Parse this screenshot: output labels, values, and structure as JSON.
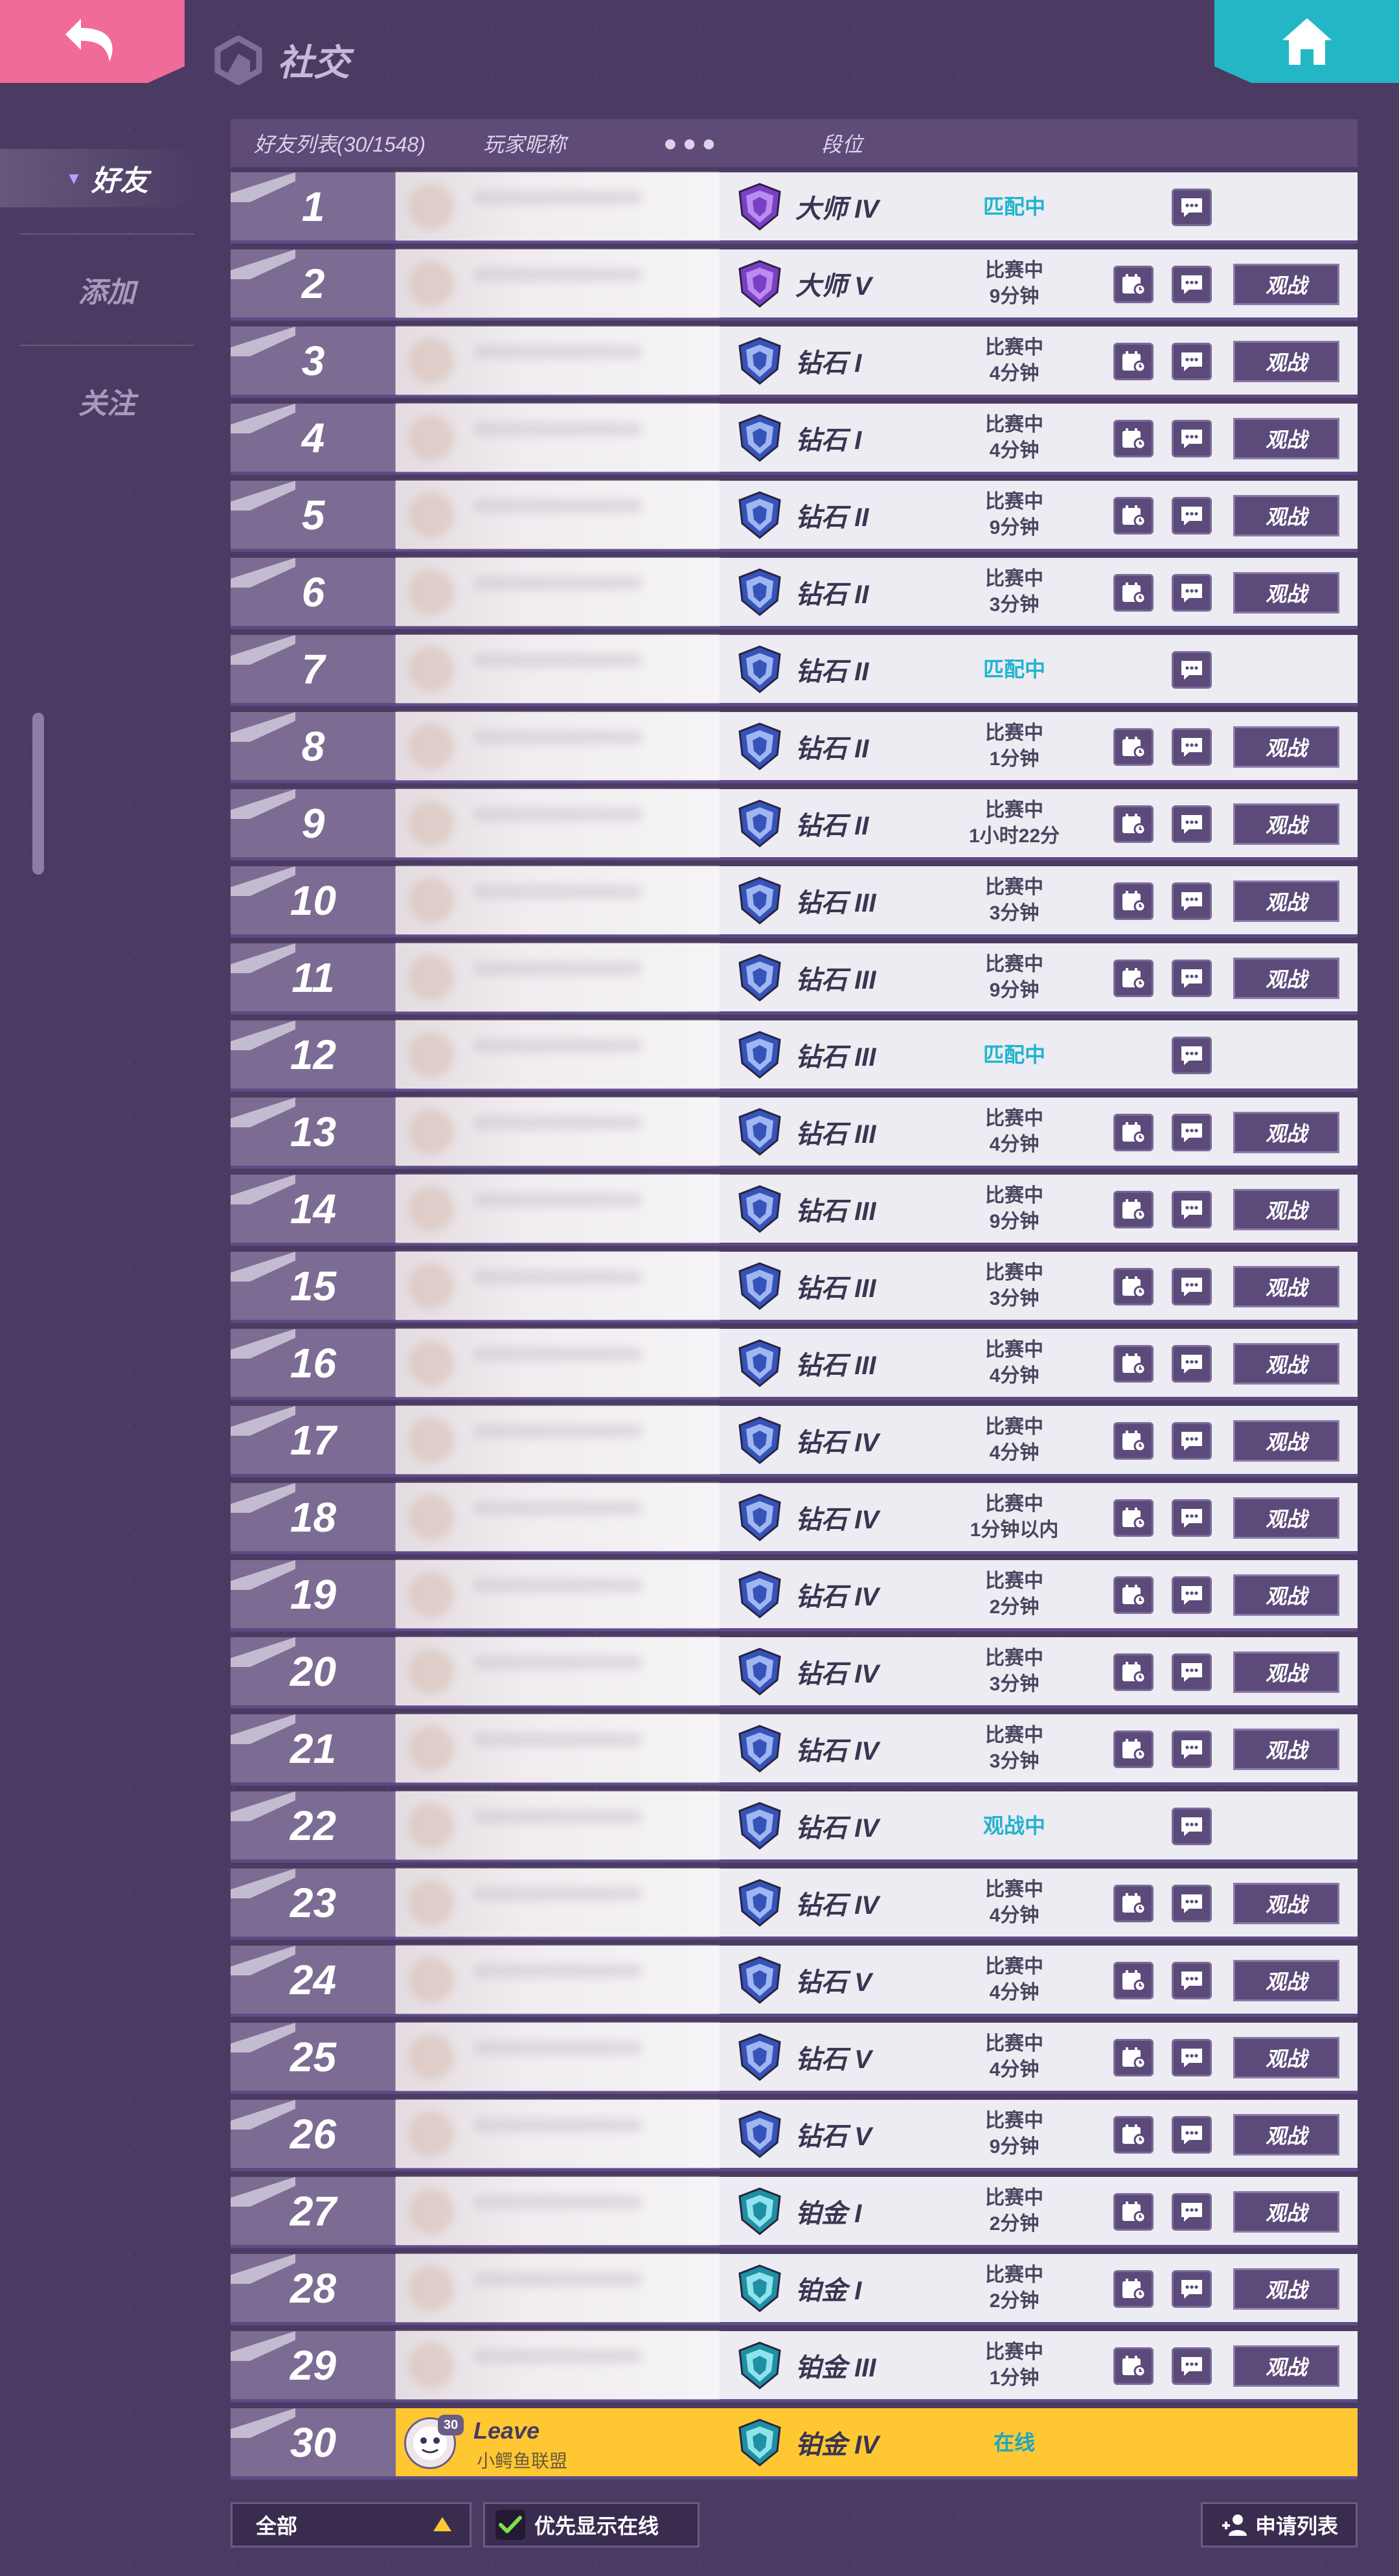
{
  "header": {
    "title": "社交",
    "back_icon": "back-arrow-icon",
    "home_icon": "home-icon"
  },
  "sidebar": {
    "items": [
      {
        "label": "好友",
        "active": true
      },
      {
        "label": "添加",
        "active": false
      },
      {
        "label": "关注",
        "active": false
      }
    ]
  },
  "columns": {
    "list": "好友列表(30/1548)",
    "name": "玩家昵称",
    "dots": "●●●",
    "rank": "段位"
  },
  "labels": {
    "watch": "观战"
  },
  "rows": [
    {
      "num": "1",
      "tier": "master",
      "rank": "大师 IV",
      "status": [
        "匹配中"
      ],
      "cyan": true,
      "spectate": false
    },
    {
      "num": "2",
      "tier": "master",
      "rank": "大师 V",
      "status": [
        "比赛中",
        "9分钟"
      ],
      "cyan": false,
      "spectate": true
    },
    {
      "num": "3",
      "tier": "diamond",
      "rank": "钻石 I",
      "status": [
        "比赛中",
        "4分钟"
      ],
      "cyan": false,
      "spectate": true
    },
    {
      "num": "4",
      "tier": "diamond",
      "rank": "钻石 I",
      "status": [
        "比赛中",
        "4分钟"
      ],
      "cyan": false,
      "spectate": true
    },
    {
      "num": "5",
      "tier": "diamond",
      "rank": "钻石 II",
      "status": [
        "比赛中",
        "9分钟"
      ],
      "cyan": false,
      "spectate": true
    },
    {
      "num": "6",
      "tier": "diamond",
      "rank": "钻石 II",
      "status": [
        "比赛中",
        "3分钟"
      ],
      "cyan": false,
      "spectate": true
    },
    {
      "num": "7",
      "tier": "diamond",
      "rank": "钻石 II",
      "status": [
        "匹配中"
      ],
      "cyan": true,
      "spectate": false
    },
    {
      "num": "8",
      "tier": "diamond",
      "rank": "钻石 II",
      "status": [
        "比赛中",
        "1分钟"
      ],
      "cyan": false,
      "spectate": true
    },
    {
      "num": "9",
      "tier": "diamond",
      "rank": "钻石 II",
      "status": [
        "比赛中",
        "1小时22分"
      ],
      "cyan": false,
      "spectate": true
    },
    {
      "num": "10",
      "tier": "diamond",
      "rank": "钻石 III",
      "status": [
        "比赛中",
        "3分钟"
      ],
      "cyan": false,
      "spectate": true
    },
    {
      "num": "11",
      "tier": "diamond",
      "rank": "钻石 III",
      "status": [
        "比赛中",
        "9分钟"
      ],
      "cyan": false,
      "spectate": true
    },
    {
      "num": "12",
      "tier": "diamond",
      "rank": "钻石 III",
      "status": [
        "匹配中"
      ],
      "cyan": true,
      "spectate": false
    },
    {
      "num": "13",
      "tier": "diamond",
      "rank": "钻石 III",
      "status": [
        "比赛中",
        "4分钟"
      ],
      "cyan": false,
      "spectate": true
    },
    {
      "num": "14",
      "tier": "diamond",
      "rank": "钻石 III",
      "status": [
        "比赛中",
        "9分钟"
      ],
      "cyan": false,
      "spectate": true
    },
    {
      "num": "15",
      "tier": "diamond",
      "rank": "钻石 III",
      "status": [
        "比赛中",
        "3分钟"
      ],
      "cyan": false,
      "spectate": true
    },
    {
      "num": "16",
      "tier": "diamond",
      "rank": "钻石 III",
      "status": [
        "比赛中",
        "4分钟"
      ],
      "cyan": false,
      "spectate": true
    },
    {
      "num": "17",
      "tier": "diamond",
      "rank": "钻石 IV",
      "status": [
        "比赛中",
        "4分钟"
      ],
      "cyan": false,
      "spectate": true
    },
    {
      "num": "18",
      "tier": "diamond",
      "rank": "钻石 IV",
      "status": [
        "比赛中",
        "1分钟以内"
      ],
      "cyan": false,
      "spectate": true
    },
    {
      "num": "19",
      "tier": "diamond",
      "rank": "钻石 IV",
      "status": [
        "比赛中",
        "2分钟"
      ],
      "cyan": false,
      "spectate": true
    },
    {
      "num": "20",
      "tier": "diamond",
      "rank": "钻石 IV",
      "status": [
        "比赛中",
        "3分钟"
      ],
      "cyan": false,
      "spectate": true
    },
    {
      "num": "21",
      "tier": "diamond",
      "rank": "钻石 IV",
      "status": [
        "比赛中",
        "3分钟"
      ],
      "cyan": false,
      "spectate": true
    },
    {
      "num": "22",
      "tier": "diamond",
      "rank": "钻石 IV",
      "status": [
        "观战中"
      ],
      "cyan": true,
      "spectate": false
    },
    {
      "num": "23",
      "tier": "diamond",
      "rank": "钻石 IV",
      "status": [
        "比赛中",
        "4分钟"
      ],
      "cyan": false,
      "spectate": true
    },
    {
      "num": "24",
      "tier": "diamond",
      "rank": "钻石 V",
      "status": [
        "比赛中",
        "4分钟"
      ],
      "cyan": false,
      "spectate": true
    },
    {
      "num": "25",
      "tier": "diamond",
      "rank": "钻石 V",
      "status": [
        "比赛中",
        "4分钟"
      ],
      "cyan": false,
      "spectate": true
    },
    {
      "num": "26",
      "tier": "diamond",
      "rank": "钻石 V",
      "status": [
        "比赛中",
        "9分钟"
      ],
      "cyan": false,
      "spectate": true
    },
    {
      "num": "27",
      "tier": "platinum",
      "rank": "铂金 I",
      "status": [
        "比赛中",
        "2分钟"
      ],
      "cyan": false,
      "spectate": true
    },
    {
      "num": "28",
      "tier": "platinum",
      "rank": "铂金 I",
      "status": [
        "比赛中",
        "2分钟"
      ],
      "cyan": false,
      "spectate": true
    },
    {
      "num": "29",
      "tier": "platinum",
      "rank": "铂金 III",
      "status": [
        "比赛中",
        "1分钟"
      ],
      "cyan": false,
      "spectate": true
    }
  ],
  "me": {
    "num": "30",
    "level": "30",
    "name": "Leave",
    "club": "小鳄鱼联盟",
    "rank": "铂金 IV",
    "tier": "platinum",
    "status": "在线"
  },
  "footer": {
    "filter_value": "全部",
    "online_first": "优先显示在线",
    "apply_list": "申请列表"
  },
  "colors": {
    "background": "#4b3b63",
    "back_button": "#f06a9a",
    "home_button": "#23b7c6",
    "self_row": "#ffc833",
    "status_cyan": "#21b3cf",
    "tier_master": "#8a4fd1",
    "tier_diamond": "#3d5fc4",
    "tier_platinum": "#2aa7b8"
  }
}
